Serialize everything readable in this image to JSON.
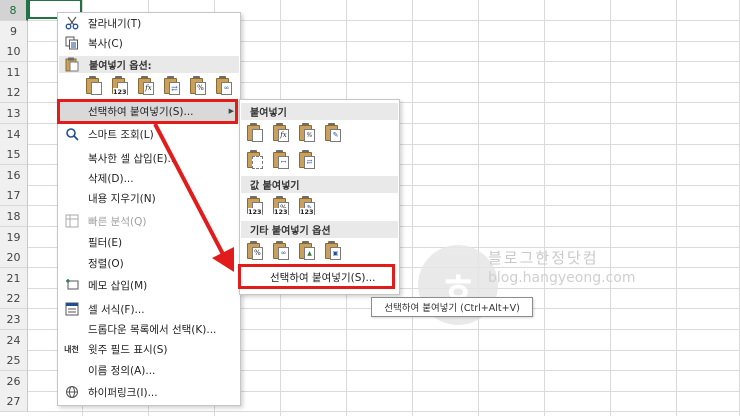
{
  "row_numbers": [
    "8",
    "9",
    "10",
    "11",
    "12",
    "13",
    "14",
    "15",
    "16",
    "17",
    "18",
    "19",
    "20",
    "21",
    "22",
    "23",
    "24",
    "25",
    "26",
    "27"
  ],
  "context_menu": {
    "cut": "잘라내기(T)",
    "copy": "복사(C)",
    "paste_options_header": "붙여넣기 옵션:",
    "paste_options_nums": [
      "123"
    ],
    "paste_special": "선택하여 붙여넣기(S)...",
    "smart_lookup": "스마트 조회(L)",
    "insert_copied": "복사한 셀 삽입(E)...",
    "delete": "삭제(D)...",
    "clear_contents": "내용 지우기(N)",
    "quick_analysis": "빠른 분석(Q)",
    "filter": "필터(E)",
    "sort": "정렬(O)",
    "insert_comment": "메모 삽입(M)",
    "format_cells": "셀 서식(F)...",
    "pick_from_dropdown": "드롭다운 목록에서 선택(K)...",
    "phonetic": "윗주 필드 표시(S)",
    "define_name": "이름 정의(A)...",
    "hyperlink": "하이퍼링크(I)...",
    "phonetic_icon_text": "내천"
  },
  "submenu": {
    "paste_header": "붙여넣기",
    "values_header": "값 붙여넣기",
    "other_header": "기타 붙여넣기 옵션",
    "paste_special": "선택하여 붙여넣기(S)...",
    "fx": "fx",
    "pct": "%",
    "num": "123"
  },
  "tooltip": "선택하여 붙여넣기 (Ctrl+Alt+V)",
  "watermark": {
    "title": "블로그한정닷컴",
    "url": "blog.hangyeong.com"
  },
  "colors": {
    "highlight_red": "#e21b1b",
    "excel_green": "#217346"
  },
  "icons": [
    "scissors-icon",
    "copy-icon",
    "clipboard-icon",
    "search-icon",
    "analysis-icon",
    "comment-icon",
    "format-cells-icon",
    "phonetic-icon",
    "hyperlink-icon",
    "submenu-arrow-icon"
  ]
}
